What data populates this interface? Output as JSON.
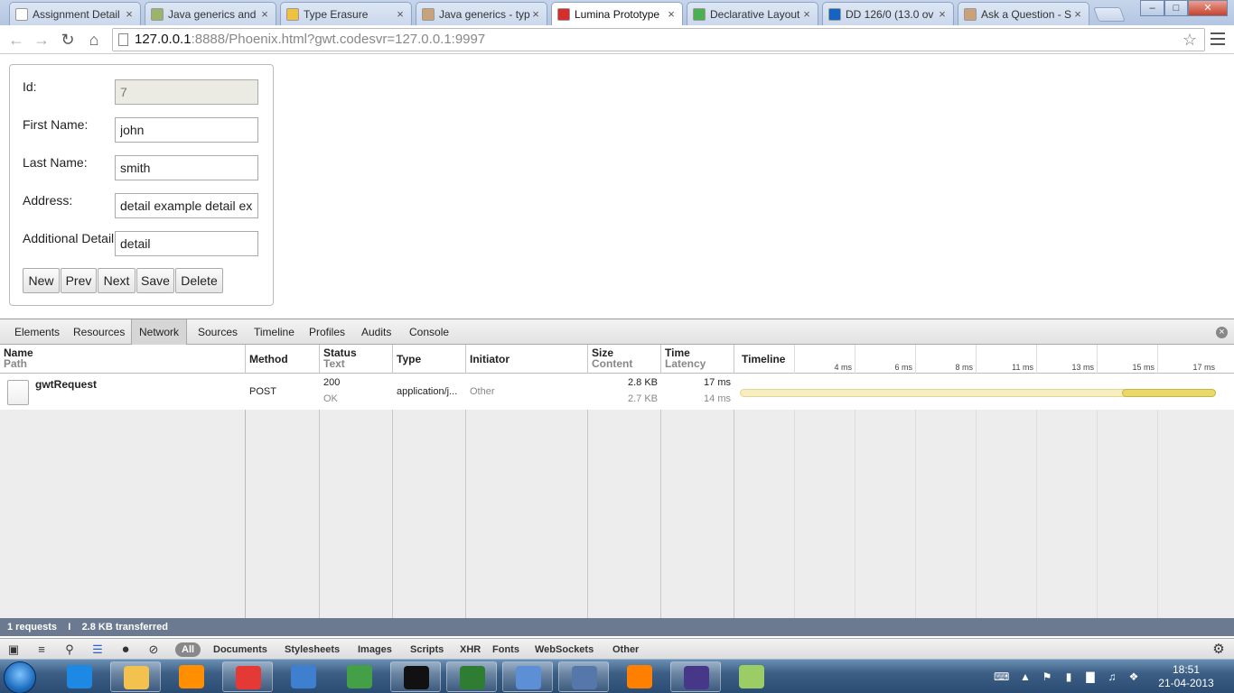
{
  "browser": {
    "tabs": [
      {
        "title": "Assignment Detail",
        "favicon_color": "#ffffff"
      },
      {
        "title": "Java generics and",
        "favicon_color": "#9bb36a"
      },
      {
        "title": "Type Erasure",
        "favicon_color": "#f0c040"
      },
      {
        "title": "Java generics - typ",
        "favicon_color": "#c7a27a"
      },
      {
        "title": "Lumina Prototype",
        "favicon_color": "#d32f2f"
      },
      {
        "title": "Declarative Layout",
        "favicon_color": "#4caf50"
      },
      {
        "title": "DD 126/0 (13.0 ov",
        "favicon_color": "#1565c0"
      },
      {
        "title": "Ask a Question - S",
        "favicon_color": "#c7a27a"
      }
    ],
    "active_tab": 4,
    "url_host": "127.0.0.1",
    "url_rest": ":8888/Phoenix.html?gwt.codesvr=127.0.0.1:9997",
    "close_glyph": "×",
    "window_buttons": {
      "minimize": "–",
      "maximize": "□",
      "close": "✕"
    }
  },
  "form": {
    "fields": [
      {
        "label": "Id:",
        "value": "7",
        "readonly": true
      },
      {
        "label": "First Name:",
        "value": "john",
        "readonly": false
      },
      {
        "label": "Last Name:",
        "value": "smith",
        "readonly": false
      },
      {
        "label": "Address:",
        "value": "detail example detail example",
        "readonly": false
      },
      {
        "label": "Additional Detail:",
        "value": "detail",
        "readonly": false
      }
    ],
    "buttons": [
      "New",
      "Prev",
      "Next",
      "Save",
      "Delete"
    ]
  },
  "devtools": {
    "tabs": [
      "Elements",
      "Resources",
      "Network",
      "Sources",
      "Timeline",
      "Profiles",
      "Audits",
      "Console"
    ],
    "active_tab": "Network",
    "columns": {
      "name": {
        "title": "Name",
        "sub": "Path"
      },
      "method": {
        "title": "Method"
      },
      "status": {
        "title": "Status",
        "sub": "Text"
      },
      "type": {
        "title": "Type"
      },
      "initiator": {
        "title": "Initiator"
      },
      "size": {
        "title": "Size",
        "sub": "Content"
      },
      "time": {
        "title": "Time",
        "sub": "Latency"
      },
      "timeline": {
        "title": "Timeline"
      }
    },
    "timeline_ticks": [
      "4 ms",
      "6 ms",
      "8 ms",
      "11 ms",
      "13 ms",
      "15 ms",
      "17 ms"
    ],
    "requests": [
      {
        "name": "gwtRequest",
        "method": "POST",
        "status": "200",
        "status_text": "OK",
        "type": "application/j...",
        "initiator": "Other",
        "size": "2.8 KB",
        "content": "2.7 KB",
        "time": "17 ms",
        "latency": "14 ms"
      }
    ],
    "summary": {
      "requests": "1 requests",
      "separator": "I",
      "transferred": "2.8 KB transferred"
    },
    "filters": [
      "All",
      "Documents",
      "Stylesheets",
      "Images",
      "Scripts",
      "XHR",
      "Fonts",
      "WebSockets",
      "Other"
    ],
    "active_filter": "All"
  },
  "taskbar": {
    "apps": [
      {
        "icon": "internet-explorer-icon",
        "color": "#1e88e5",
        "open": false
      },
      {
        "icon": "file-explorer-icon",
        "color": "#f2c14e",
        "open": true
      },
      {
        "icon": "media-player-icon",
        "color": "#ff8f00",
        "open": false
      },
      {
        "icon": "chrome-icon",
        "color": "#e53935",
        "open": true
      },
      {
        "icon": "thunderbird-icon",
        "color": "#3f7fd0",
        "open": false
      },
      {
        "icon": "excel-icon",
        "color": "#43a047",
        "open": false
      },
      {
        "icon": "command-prompt-icon",
        "color": "#111111",
        "open": true
      },
      {
        "icon": "terminal-icon",
        "color": "#2e7d32",
        "open": true
      },
      {
        "icon": "word-icon",
        "color": "#5c8fd6",
        "open": true
      },
      {
        "icon": "thunderbird-mail-icon",
        "color": "#5577aa",
        "open": true
      },
      {
        "icon": "vlc-icon",
        "color": "#ff7f00",
        "open": false
      },
      {
        "icon": "eclipse-icon",
        "color": "#473788",
        "open": true
      },
      {
        "icon": "paint-icon",
        "color": "#9ccc65",
        "open": false
      }
    ],
    "clock_time": "18:51",
    "clock_date": "21-04-2013"
  }
}
